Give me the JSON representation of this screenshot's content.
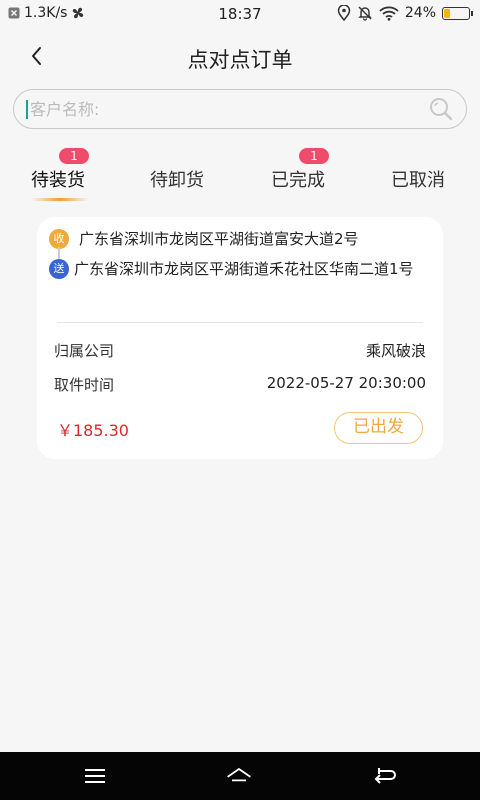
{
  "status_bar": {
    "speed": "1.3K/s",
    "time": "18:37",
    "battery": "24%",
    "battery_level": 0.24,
    "icons": [
      "close-box-icon",
      "fan-icon",
      "location-icon",
      "mute-icon",
      "wifi-icon",
      "battery-icon"
    ]
  },
  "header": {
    "title": "点对点订单"
  },
  "search": {
    "placeholder": "客户名称:"
  },
  "tabs": [
    {
      "label": "待装货",
      "badge": "1",
      "active": true
    },
    {
      "label": "待卸货",
      "badge": ""
    },
    {
      "label": "已完成",
      "badge": "1"
    },
    {
      "label": "已取消",
      "badge": ""
    }
  ],
  "order": {
    "recv_tag": "收",
    "recv_address": "广东省深圳市龙岗区平湖街道富安大道2号",
    "send_tag": "送",
    "send_address": "广东省深圳市龙岗区平湖街道禾花社区华南二道1号",
    "company_label": "归属公司",
    "company_value": "乘风破浪",
    "time_label": "取件时间",
    "time_value": "2022-05-27 20:30:00",
    "price": "￥185.30",
    "status": "已出发"
  },
  "colors": {
    "accent": "#f0a032",
    "badge": "#f04b6a",
    "price": "#e0262b"
  }
}
